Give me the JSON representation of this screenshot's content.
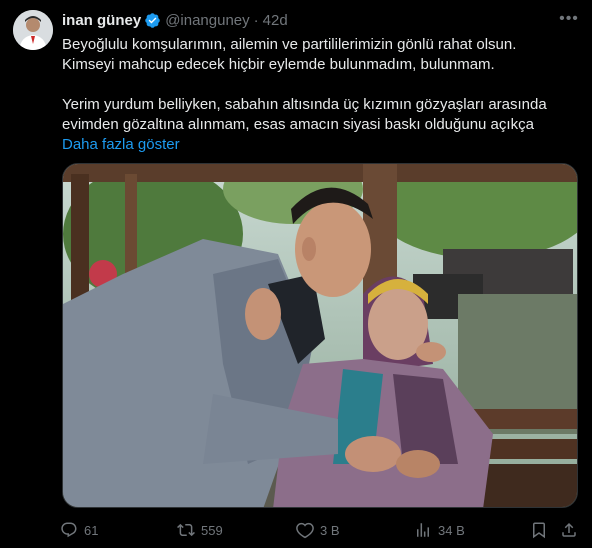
{
  "author": {
    "name": "inan güney",
    "handle": "@inanguney",
    "separator": "·",
    "time": "42d"
  },
  "tweet": {
    "lines_p1": [
      "Beyoğlulu komşularımın, ailemin ve partililerimizin gönlü rahat olsun.",
      "Kimseyi mahcup edecek hiçbir eylemde bulunmadım, bulunmam."
    ],
    "lines_p2": [
      "Yerim yurdum belliyken, sabahın altısında üç kızımın gözyaşları arasında",
      "evimden gözaltına alınmam, esas amacın siyasi baskı olduğunu açıkça"
    ],
    "show_more": "Daha fazla göster"
  },
  "actions": {
    "replies": "61",
    "retweets": "559",
    "likes": "3 B",
    "views": "34 B"
  },
  "colors": {
    "background": "#000000",
    "text": "#e7e9ea",
    "muted": "#71767b",
    "link": "#1d9bf0",
    "verified": "#1d9bf0"
  }
}
